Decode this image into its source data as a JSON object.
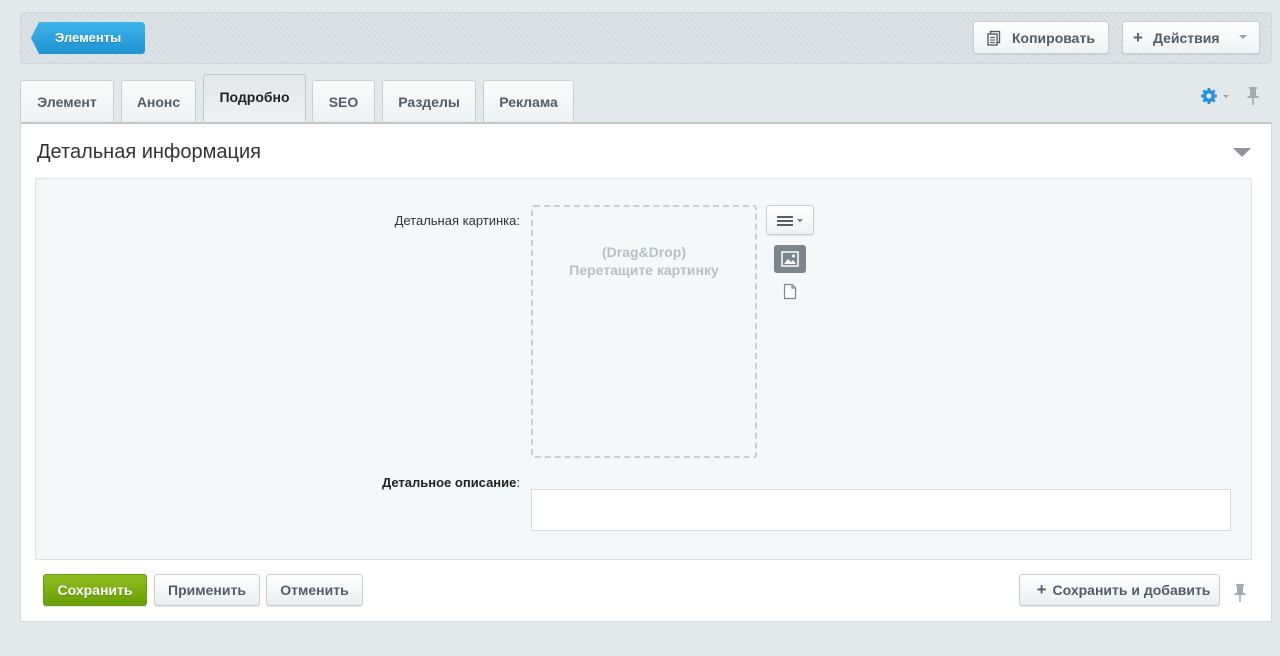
{
  "toolbar": {
    "back_label": "Элементы",
    "copy_label": "Копировать",
    "copy_icon": "copy-icon",
    "actions_label": "Действия",
    "actions_icon": "plus-icon"
  },
  "tabs": [
    {
      "label": "Элемент",
      "active": false
    },
    {
      "label": "Анонс",
      "active": false
    },
    {
      "label": "Подробно",
      "active": true
    },
    {
      "label": "SEO",
      "active": false
    },
    {
      "label": "Разделы",
      "active": false
    },
    {
      "label": "Реклама",
      "active": false
    }
  ],
  "section": {
    "title": "Детальная информация",
    "picture_label": "Детальная картинка",
    "dropzone_line1": "(Drag&Drop)",
    "dropzone_line2": "Перетащите картинку",
    "description_label": "Детальное описание",
    "colon": ":",
    "description_value": ""
  },
  "footer": {
    "save_label": "Сохранить",
    "apply_label": "Применить",
    "cancel_label": "Отменить",
    "save_add_label": "Сохранить и добавить"
  },
  "colors": {
    "accent_blue": "#1e93d2",
    "save_green": "#67a008",
    "gear_blue": "#2b8fd8"
  }
}
